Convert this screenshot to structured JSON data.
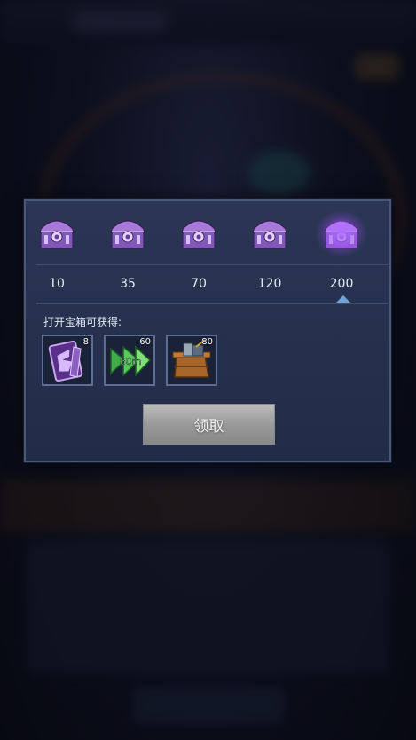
{
  "milestones": [
    {
      "value": "10",
      "active": false
    },
    {
      "value": "35",
      "active": false
    },
    {
      "value": "70",
      "active": false
    },
    {
      "value": "120",
      "active": false
    },
    {
      "value": "200",
      "active": true
    }
  ],
  "rewards_title": "打开宝箱可获得:",
  "rewards": [
    {
      "icon": "spellbook-icon",
      "count": "8"
    },
    {
      "icon": "speedup-60m-icon",
      "count": "60",
      "badge_text": "60m"
    },
    {
      "icon": "resource-crate-icon",
      "count": "80"
    }
  ],
  "claim_button_label": "领取",
  "colors": {
    "accent": "#6fa2d8",
    "chest": "#a878e0",
    "panel": "#26304c"
  }
}
